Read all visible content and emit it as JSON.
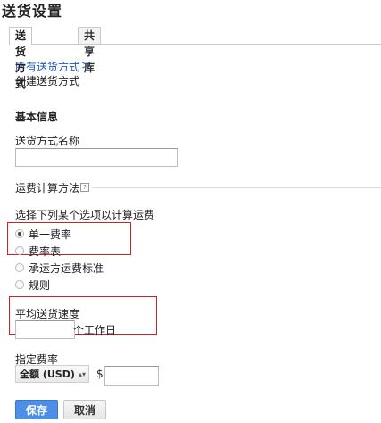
{
  "page": {
    "title": "送货设置"
  },
  "tabs": [
    {
      "label": "送货方式",
      "active": true
    },
    {
      "label": "共享库",
      "active": false
    }
  ],
  "breadcrumb": {
    "link": "所有送货方式",
    "separator": ">",
    "current": "创建送货方式"
  },
  "basic_info": {
    "heading": "基本信息",
    "name_label": "送货方式名称",
    "name_value": ""
  },
  "calc": {
    "heading": "运费计算方法",
    "help_icon": "help-icon",
    "prompt": "选择下列某个选项以计算运费",
    "options": [
      {
        "label": "单一费率",
        "selected": true
      },
      {
        "label": "费率表",
        "selected": false
      },
      {
        "label": "承运方运费标准",
        "selected": false
      },
      {
        "label": "规则",
        "selected": false
      }
    ]
  },
  "speed": {
    "label": "平均送货速度",
    "value": "",
    "unit": "个工作日"
  },
  "rate": {
    "label": "指定费率",
    "currency": "全额 (USD)",
    "currency_symbol": "$",
    "amount": ""
  },
  "actions": {
    "save": "保存",
    "cancel": "取消"
  },
  "colors": {
    "link": "#2255aa",
    "primary_button": "#4d8ee8",
    "highlight_box": "#cc2222"
  }
}
